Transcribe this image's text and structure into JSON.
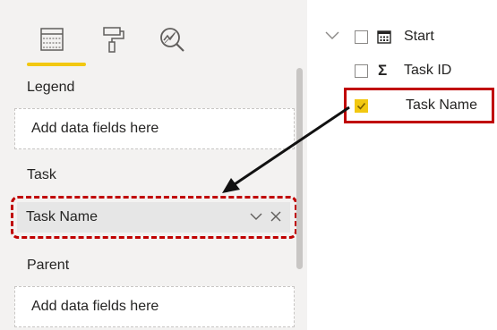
{
  "visualizations": {
    "tabs": [
      {
        "name": "fields-tab",
        "icon": "fields-grid-icon",
        "active": true
      },
      {
        "name": "format-tab",
        "icon": "paint-roller-icon",
        "active": false
      },
      {
        "name": "analytics-tab",
        "icon": "analytics-magnifier-icon",
        "active": false
      }
    ],
    "legend": {
      "label": "Legend",
      "placeholder": "Add data fields here"
    },
    "task": {
      "label": "Task",
      "field_value": "Task Name"
    },
    "parent": {
      "label": "Parent",
      "placeholder": "Add data fields here"
    }
  },
  "fields": {
    "items": [
      {
        "label": "Start",
        "icon": "calendar-icon",
        "checked": false
      },
      {
        "label": "Task ID",
        "icon": "sigma-icon",
        "checked": false
      },
      {
        "label": "Task Name",
        "icon": "",
        "checked": true
      }
    ]
  },
  "colors": {
    "accent": "#f2c811",
    "highlight": "#c00000"
  }
}
